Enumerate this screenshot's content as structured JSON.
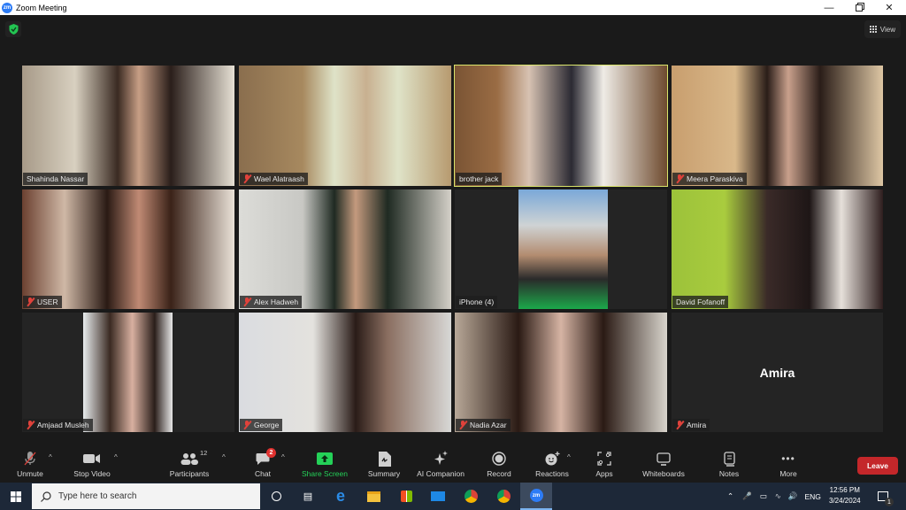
{
  "window": {
    "app_icon": "zm",
    "title": "Zoom Meeting",
    "controls": [
      "minimize",
      "restore",
      "close"
    ]
  },
  "header": {
    "security_icon": "shield-check-icon",
    "view_label": "View",
    "view_icon": "grid-icon"
  },
  "participants": [
    {
      "name": "Shahinda Nassar",
      "muted": false,
      "active_speaker": false,
      "video": true
    },
    {
      "name": "Wael Alatraash",
      "muted": true,
      "active_speaker": false,
      "video": true
    },
    {
      "name": "brother jack",
      "muted": false,
      "active_speaker": true,
      "video": true
    },
    {
      "name": "Meera Paraskiva",
      "muted": true,
      "active_speaker": false,
      "video": true
    },
    {
      "name": "USER",
      "muted": true,
      "active_speaker": false,
      "video": true
    },
    {
      "name": "Alex Hadweh",
      "muted": true,
      "active_speaker": false,
      "video": true
    },
    {
      "name": "iPhone (4)",
      "muted": false,
      "active_speaker": false,
      "video": true
    },
    {
      "name": "David Fofanoff",
      "muted": false,
      "active_speaker": false,
      "video": true
    },
    {
      "name": "Amjaad Musleh",
      "muted": true,
      "active_speaker": false,
      "video": true
    },
    {
      "name": "George",
      "muted": true,
      "active_speaker": false,
      "video": true
    },
    {
      "name": "Nadia Azar",
      "muted": true,
      "active_speaker": false,
      "video": true
    },
    {
      "name": "Amira",
      "muted": true,
      "active_speaker": false,
      "video": false,
      "center_label": "Amira"
    }
  ],
  "toolbar": {
    "unmute": "Unmute",
    "stop_video": "Stop Video",
    "participants": "Participants",
    "participants_count": "12",
    "chat": "Chat",
    "chat_badge": "2",
    "share_screen": "Share Screen",
    "summary": "Summary",
    "ai_companion": "AI Companion",
    "record": "Record",
    "reactions": "Reactions",
    "apps": "Apps",
    "whiteboards": "Whiteboards",
    "notes": "Notes",
    "more": "More",
    "leave": "Leave",
    "caret": "^"
  },
  "taskbar": {
    "search_placeholder": "Type here to search",
    "apps": [
      "cortana",
      "task-view",
      "edge",
      "file-explorer",
      "store",
      "mail",
      "chrome",
      "chrome-profile",
      "zoom"
    ],
    "language": "ENG",
    "time": "12:56 PM",
    "date": "3/24/2024",
    "notification_count": "1"
  },
  "colors": {
    "active_speaker_border": "#d8e36a",
    "share_screen_green": "#24d158",
    "leave_red": "#c4272a",
    "muted_red": "#e0423b"
  }
}
